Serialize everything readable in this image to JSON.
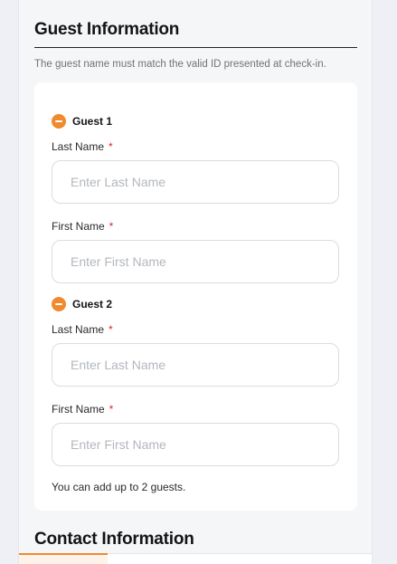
{
  "guest_section": {
    "title": "Guest Information",
    "notice": "The guest name must match the valid ID presented at check-in."
  },
  "guests": [
    {
      "label": "Guest 1",
      "last_name": {
        "label": "Last Name",
        "required_mark": "*",
        "placeholder": "Enter Last Name",
        "value": ""
      },
      "first_name": {
        "label": "First Name",
        "required_mark": "*",
        "placeholder": "Enter First Name",
        "value": ""
      }
    },
    {
      "label": "Guest 2",
      "last_name": {
        "label": "Last Name",
        "required_mark": "*",
        "placeholder": "Enter Last Name",
        "value": ""
      },
      "first_name": {
        "label": "First Name",
        "required_mark": "*",
        "placeholder": "Enter First Name",
        "value": ""
      }
    }
  ],
  "guest_limit_note": "You can add up to 2 guests.",
  "contact_section": {
    "title": "Contact Information"
  },
  "icons": {
    "remove_guest": "minus-circle-icon"
  },
  "colors": {
    "accent": "#f08a2e",
    "required": "#e0262c"
  }
}
